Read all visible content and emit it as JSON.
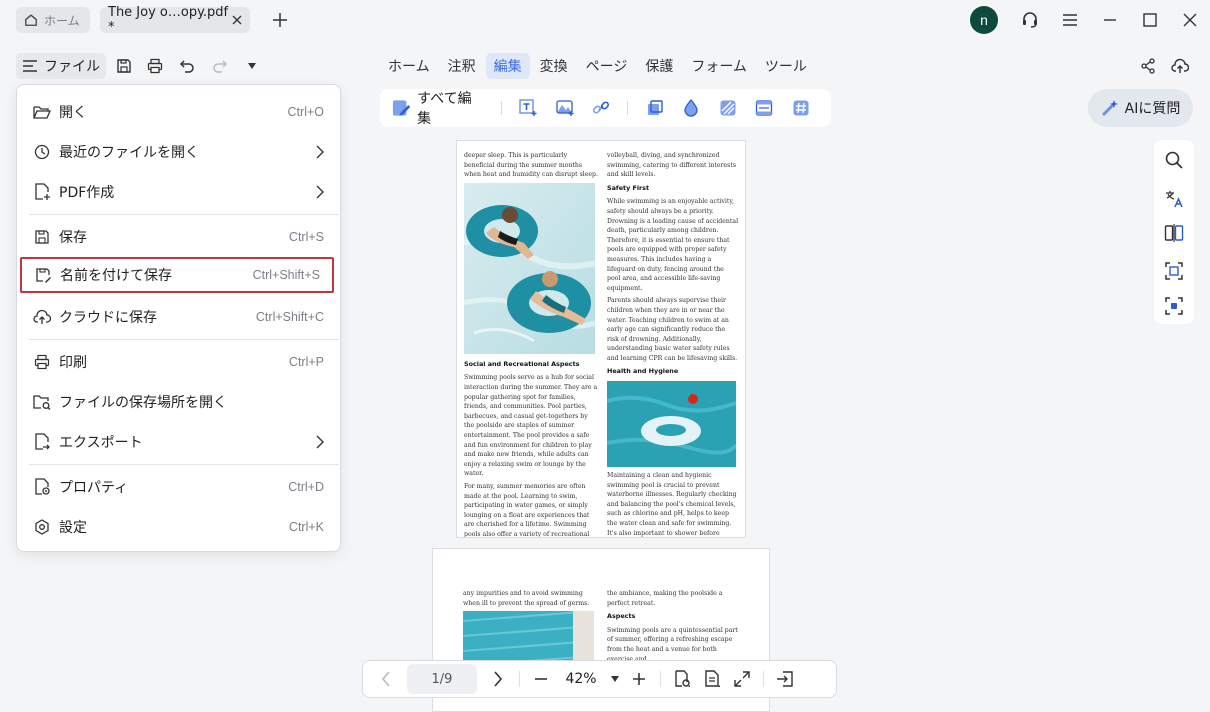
{
  "titlebar": {
    "home_tab": "ホーム",
    "doc_tab": "The Joy o…opy.pdf *",
    "avatar_initial": "n"
  },
  "toolbar": {
    "file_label": "ファイル",
    "menu_tabs": [
      "ホーム",
      "注釈",
      "編集",
      "変換",
      "ページ",
      "保護",
      "フォーム",
      "ツール"
    ],
    "active_tab": "編集"
  },
  "edit_tools": {
    "edit_all_label": "すべて編集"
  },
  "ask_ai_label": "AIに質問",
  "file_menu": {
    "items": [
      {
        "label": "開く",
        "shortcut": "Ctrl+O",
        "icon": "folder-open-icon"
      },
      {
        "label": "最近のファイルを開く",
        "shortcut": "",
        "icon": "clock-icon",
        "submenu": true
      },
      {
        "label": "PDF作成",
        "shortcut": "",
        "icon": "create-pdf-icon",
        "submenu": true
      },
      {
        "label": "保存",
        "shortcut": "Ctrl+S",
        "icon": "save-icon"
      },
      {
        "label": "名前を付けて保存",
        "shortcut": "Ctrl+Shift+S",
        "icon": "save-as-icon",
        "highlighted": true
      },
      {
        "label": "クラウドに保存",
        "shortcut": "Ctrl+Shift+C",
        "icon": "cloud-upload-icon"
      },
      {
        "label": "印刷",
        "shortcut": "Ctrl+P",
        "icon": "printer-icon"
      },
      {
        "label": "ファイルの保存場所を開く",
        "shortcut": "",
        "icon": "folder-search-icon"
      },
      {
        "label": "エクスポート",
        "shortcut": "",
        "icon": "export-icon",
        "submenu": true
      },
      {
        "label": "プロパティ",
        "shortcut": "Ctrl+D",
        "icon": "properties-icon"
      },
      {
        "label": "設定",
        "shortcut": "Ctrl+K",
        "icon": "settings-icon"
      }
    ]
  },
  "document": {
    "page1": {
      "left_top": "deeper sleep. This is particularly beneficial during the summer months when heat and humidity can disrupt sleep.",
      "social_heading": "Social and Recreational Aspects",
      "social_p1": "Swimming pools serve as a hub for social interaction during the summer. They are a popular gathering spot for families, friends, and communities. Pool parties, barbecues, and casual get-togethers by the poolside are staples of summer entertainment. The pool provides a safe and fun environment for children to play and make new friends, while adults can enjoy a relaxing swim or lounge by the water.",
      "social_p2": "For many, summer memories are often made at the pool. Learning to swim, participating in water games, or simply lounging on a float are experiences that are cherished for a lifetime. Swimming pools also offer a variety of recreational activities such as water",
      "right_top": "volleyball, diving, and synchronized swimming, catering to different interests and skill levels.",
      "safety_heading": "Safety First",
      "safety_p1": "While swimming is an enjoyable activity, safety should always be a priority. Drowning is a leading cause of accidental death, particularly among children. Therefore, it is essential to ensure that pools are equipped with proper safety measures. This includes having a lifeguard on duty, fencing around the pool area, and accessible life-saving equipment.",
      "safety_p2": "Parents should always supervise their children when they are in or near the water. Teaching children to swim at an early age can significantly reduce the risk of drowning. Additionally, understanding basic water safety rules and learning CPR can be lifesaving skills.",
      "health_heading": "Health and Hygiene",
      "health_p1": "Maintaining a clean and hygienic swimming pool is crucial to prevent waterborne illnesses. Regularly checking and balancing the pool's chemical levels, such as chlorine and pH, helps to keep the water clean and safe for swimming. It's also important to shower before entering the pool to wash off"
    },
    "page2": {
      "left_top": "any impurities and to avoid swimming when ill to prevent the spread of germs.",
      "right_top": "the ambiance, making the poolside a perfect retreat.",
      "aspects_heading": "Aspects",
      "aspects_p1": "Swimming pools are a quintessential part of summer, offering a refreshing escape from the heat and a venue for both exercise and"
    }
  },
  "nav": {
    "page_indicator": "1/9",
    "zoom": "42%"
  }
}
